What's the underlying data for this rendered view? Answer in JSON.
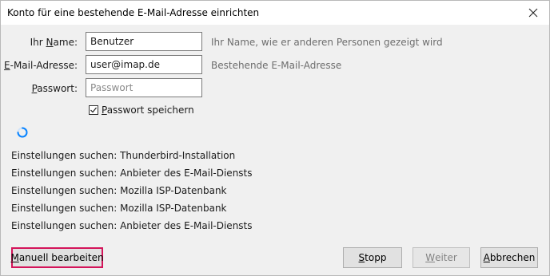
{
  "window": {
    "title": "Konto für eine bestehende E-Mail-Adresse einrichten"
  },
  "form": {
    "name": {
      "label_pre": "Ihr ",
      "label_key": "N",
      "label_post": "ame:",
      "value": "Benutzer",
      "hint": "Ihr Name, wie er anderen Personen gezeigt wird"
    },
    "email": {
      "label_pre": "",
      "label_key": "E",
      "label_post": "-Mail-Adresse:",
      "value": "user@imap.de",
      "hint": "Bestehende E-Mail-Adresse"
    },
    "password": {
      "label_pre": "",
      "label_key": "P",
      "label_post": "asswort:",
      "value": "",
      "placeholder": "Passwort"
    },
    "remember": {
      "label_key": "P",
      "label_post": "asswort speichern",
      "checked": true
    }
  },
  "status_lines": [
    "Einstellungen suchen: Thunderbird-Installation",
    "Einstellungen suchen: Anbieter des E-Mail-Diensts",
    "Einstellungen suchen: Mozilla ISP-Datenbank",
    "Einstellungen suchen: Mozilla ISP-Datenbank",
    "Einstellungen suchen: Anbieter des E-Mail-Diensts"
  ],
  "buttons": {
    "manual": {
      "key": "M",
      "rest": "anuell bearbeiten"
    },
    "stop": {
      "key": "S",
      "rest": "topp"
    },
    "next": {
      "key": "W",
      "rest": "eiter",
      "disabled": true
    },
    "cancel": {
      "key": "A",
      "rest": "bbrechen"
    }
  },
  "colors": {
    "highlight": "#d4145a",
    "spinner": "#0a84ff"
  }
}
